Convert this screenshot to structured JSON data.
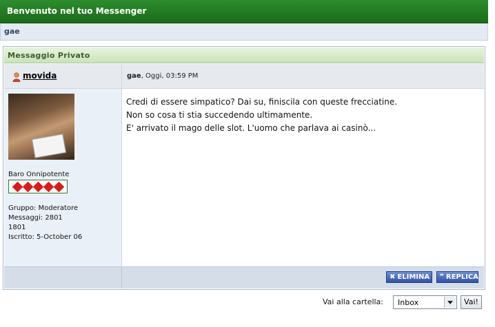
{
  "window": {
    "title": "Benvenuto nel tuo Messenger"
  },
  "userbar": {
    "username": "gae"
  },
  "panel": {
    "title": "Messaggio Privato",
    "author": {
      "name": "movida",
      "rank": "Baro Onnipotente",
      "rank_pips": 5,
      "stats": [
        "Gruppo: Moderatore",
        "Messaggi: 2801",
        "1801",
        "Iscritto: 5-October 06"
      ]
    },
    "post": {
      "sender": "gae",
      "date": ", Oggi, 03:59 PM",
      "lines": [
        "Credi di essere simpatico? Dai su, finiscila con queste frecciatine.",
        "Non so cosa ti stia succedendo ultimamente.",
        "E' arrivato il mago delle slot. L'uomo che parlava ai casinò..."
      ]
    },
    "buttons": {
      "delete": "ELIMINA",
      "reply": "REPLICA"
    }
  },
  "folder": {
    "label": "Vai alla cartella:",
    "selected": "Inbox",
    "go": "Vai!"
  },
  "colors": {
    "header": "#1f7a1f",
    "button": "#2f55a8",
    "pip": "#e01818"
  }
}
